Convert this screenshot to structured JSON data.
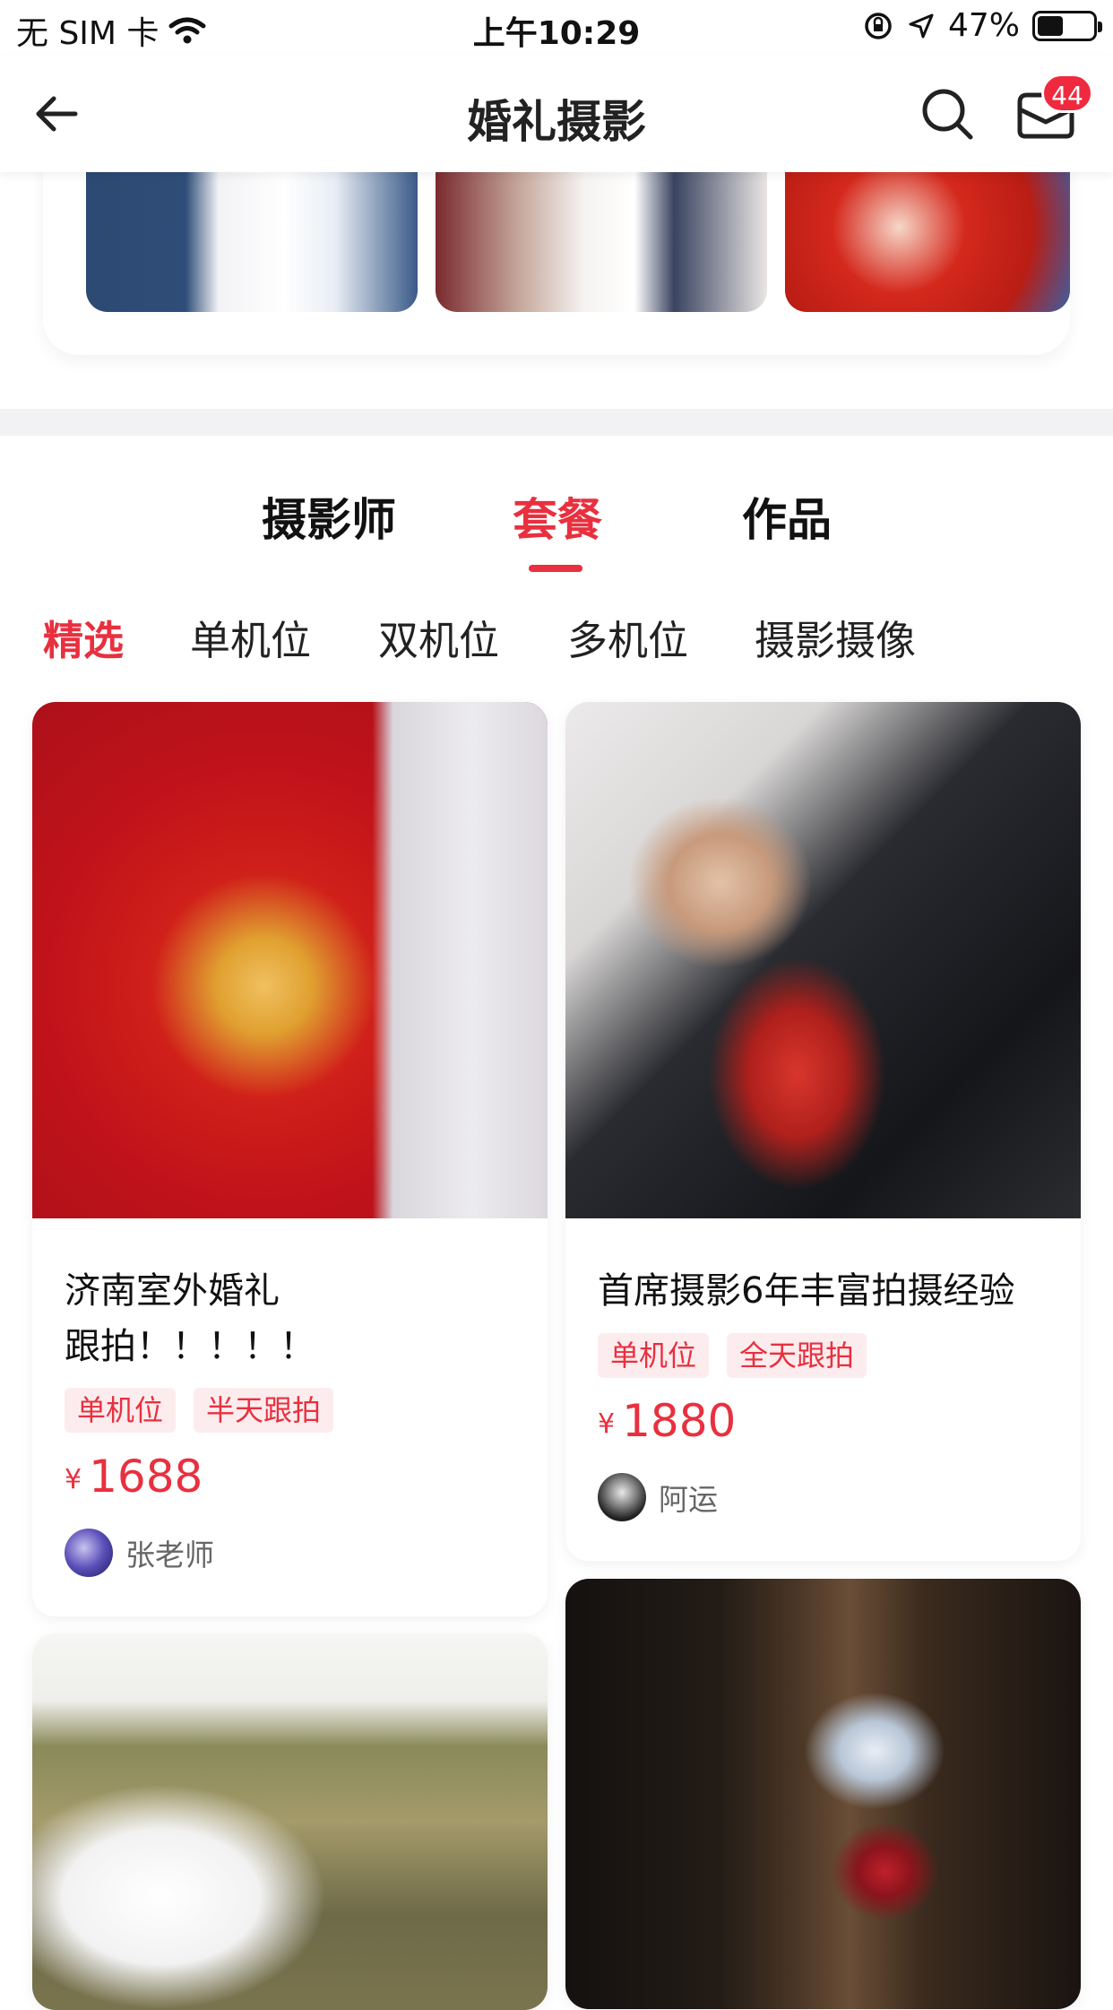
{
  "status_bar": {
    "carrier": "无 SIM 卡",
    "time": "上午10:29",
    "battery_percent": "47%",
    "battery_level": 0.47
  },
  "nav": {
    "title": "婚礼摄影",
    "badge_count": "44",
    "icons": [
      "back-arrow-icon",
      "search-icon",
      "mail-icon"
    ]
  },
  "tabs": {
    "items": [
      "摄影师",
      "套餐",
      "作品"
    ],
    "active": "套餐"
  },
  "subtabs": {
    "items": [
      "精选",
      "单机位",
      "双机位",
      "多机位",
      "摄影摄像"
    ],
    "active": "精选"
  },
  "cards": [
    {
      "title_line1": "济南室外婚礼",
      "title_line2": "跟拍！！！！！",
      "tags": [
        "单机位",
        "半天跟拍"
      ],
      "currency": "¥",
      "price": "1688",
      "author": "张老师"
    },
    {
      "title_line1": "首席摄影6年丰富拍摄经验",
      "tags": [
        "单机位",
        "全天跟拍"
      ],
      "currency": "¥",
      "price": "1880",
      "author": "阿运"
    }
  ],
  "colors": {
    "accent": "#e8303f",
    "tag_bg": "#fdecee",
    "badge": "#ef2a3e"
  }
}
